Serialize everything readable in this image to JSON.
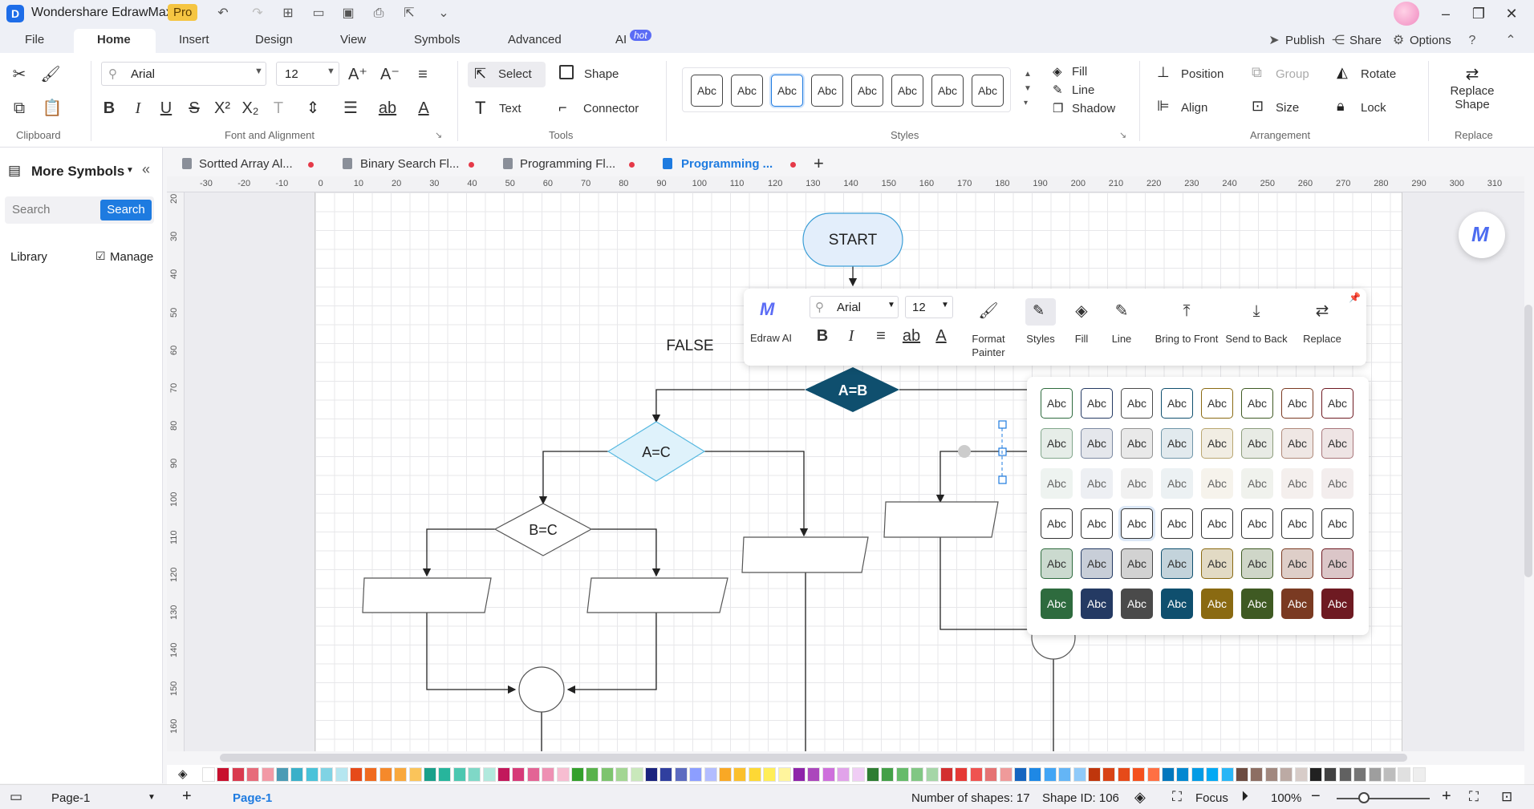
{
  "app": {
    "title": "Wondershare EdrawMax",
    "badge": "Pro"
  },
  "menu": {
    "tabs": [
      "File",
      "Home",
      "Insert",
      "Design",
      "View",
      "Symbols",
      "Advanced",
      "AI"
    ],
    "hot_badge": "hot",
    "right": {
      "publish": "Publish",
      "share": "Share",
      "options": "Options"
    }
  },
  "ribbon": {
    "font_name": "Arial",
    "font_size": "12",
    "select_label": "Select",
    "shape_label": "Shape",
    "text_label": "Text",
    "connector_label": "Connector",
    "style_swatch": "Abc",
    "fill_label": "Fill",
    "line_label": "Line",
    "shadow_label": "Shadow",
    "position_label": "Position",
    "group_label": "Group",
    "rotate_label": "Rotate",
    "align_label": "Align",
    "size_label": "Size",
    "lock_label": "Lock",
    "replace_shape_label_1": "Replace",
    "replace_shape_label_2": "Shape",
    "groups": {
      "clipboard": "Clipboard",
      "font": "Font and Alignment",
      "tools": "Tools",
      "styles": "Styles",
      "arrangement": "Arrangement",
      "replace": "Replace"
    }
  },
  "doc_tabs": [
    "Sortted Array Al...",
    "Binary Search Fl...",
    "Programming Fl...",
    "Programming ..."
  ],
  "left_panel": {
    "title": "More Symbols",
    "search_placeholder": "Search",
    "search_button": "Search",
    "library": "Library",
    "manage": "Manage"
  },
  "ruler": {
    "h": [
      "-30",
      "-20",
      "-10",
      "0",
      "10",
      "20",
      "30",
      "40",
      "50",
      "60",
      "70",
      "80",
      "90",
      "100",
      "110",
      "120",
      "130",
      "140",
      "150",
      "160",
      "170",
      "180",
      "190",
      "200",
      "210",
      "220",
      "230",
      "240",
      "250",
      "260",
      "270",
      "280",
      "290",
      "300",
      "310"
    ],
    "v": [
      "20",
      "30",
      "40",
      "50",
      "60",
      "70",
      "80",
      "90",
      "100",
      "110",
      "120",
      "130",
      "140",
      "150",
      "160"
    ]
  },
  "diagram": {
    "start": "START",
    "false_label": "FALSE",
    "d1": "A=B",
    "d2": "A=C",
    "d3": "B=C"
  },
  "floatbar": {
    "edraw_ai": "Edraw AI",
    "font_name": "Arial",
    "font_size": "12",
    "format_painter_1": "Format",
    "format_painter_2": "Painter",
    "styles": "Styles",
    "fill": "Fill",
    "line": "Line",
    "bring_front": "Bring to Front",
    "send_back": "Send to Back",
    "replace": "Replace"
  },
  "style_grid": {
    "label": "Abc",
    "colors": [
      "#2e6b3e",
      "#243a63",
      "#4a4a4a",
      "#0f4f6e",
      "#8a6a12",
      "#3f5a23",
      "#7a3a22",
      "#6e1a22"
    ]
  },
  "status": {
    "page_select": "Page-1",
    "page_tab": "Page-1",
    "shapes": "Number of shapes: 17",
    "shape_id": "Shape ID: 106",
    "focus": "Focus",
    "zoom": "100%"
  },
  "palette": [
    "#ffffff",
    "#c8102e",
    "#d93a4e",
    "#e76b7a",
    "#f29aa6",
    "#4a9bb5",
    "#3ab0c9",
    "#49c2d9",
    "#7fd3e4",
    "#b5e6f0",
    "#e64a19",
    "#f06a1e",
    "#f5892b",
    "#f9a83c",
    "#fbc45a",
    "#1aa08a",
    "#27b59c",
    "#4cc7b0",
    "#7fd8c7",
    "#b1e9dd",
    "#c2185b",
    "#d63a78",
    "#e36495",
    "#ee90b3",
    "#f7bdd1",
    "#33a02c",
    "#59b24c",
    "#7dc46e",
    "#a3d693",
    "#c9e8bb",
    "#1a237e",
    "#303f9f",
    "#5c6bc0",
    "#8c9eff",
    "#b3bdff",
    "#f9a825",
    "#fbc02d",
    "#fdd835",
    "#ffee58",
    "#fff59d",
    "#8e24aa",
    "#ab47bc",
    "#ce6fdc",
    "#e1a3ea",
    "#f0cdf5",
    "#2e7d32",
    "#43a047",
    "#66bb6a",
    "#81c784",
    "#a5d6a7",
    "#d32f2f",
    "#e53935",
    "#ef5350",
    "#e57373",
    "#ef9a9a",
    "#1565c0",
    "#1e88e5",
    "#42a5f5",
    "#64b5f6",
    "#90caf9",
    "#bf360c",
    "#d84315",
    "#e64a19",
    "#f4511e",
    "#ff7043",
    "#0277bd",
    "#0288d1",
    "#039be5",
    "#03a9f4",
    "#29b6f6",
    "#6d4c41",
    "#8d6e63",
    "#a1887f",
    "#bcaaa4",
    "#d7ccc8",
    "#212121",
    "#424242",
    "#616161",
    "#757575",
    "#9e9e9e",
    "#bdbdbd",
    "#e0e0e0",
    "#eeeeee"
  ]
}
